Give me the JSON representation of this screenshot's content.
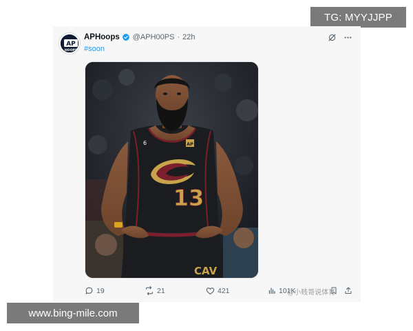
{
  "overlay": {
    "top_right_label": "TG: MYYJJPP",
    "bottom_left_url": "www.bing-mile.com",
    "bottom_watermark": "@小贱哥说体育"
  },
  "tweet": {
    "author_name": "APHoops",
    "author_handle": "@APH00PS",
    "separator": "·",
    "time_ago": "22h",
    "text": "#soon",
    "verified": true,
    "avatar_text_top": "AP",
    "avatar_text_bottom": "HOOPS",
    "media": {
      "jersey_number": "13",
      "jersey_patch_number": "6",
      "jersey_patch_text": "AP",
      "shorts_text": "CAV",
      "subject": "basketball player in dark Cleveland Cavaliers jersey"
    },
    "stats": {
      "replies": "19",
      "reposts": "21",
      "likes": "421",
      "views": "101K"
    },
    "icons": {
      "verified": "verified-badge-icon",
      "grok": "grok-icon",
      "more": "more-options-icon",
      "reply": "reply-icon",
      "repost": "repost-icon",
      "like": "like-icon",
      "views": "views-icon",
      "bookmark": "bookmark-icon",
      "share": "share-icon"
    },
    "colors": {
      "link": "#1d9bf0",
      "verified": "#1d9bf0",
      "muted": "#536471",
      "jersey": "#1b1c1f",
      "wine": "#7a1f2b",
      "gold": "#c7a34b"
    }
  }
}
